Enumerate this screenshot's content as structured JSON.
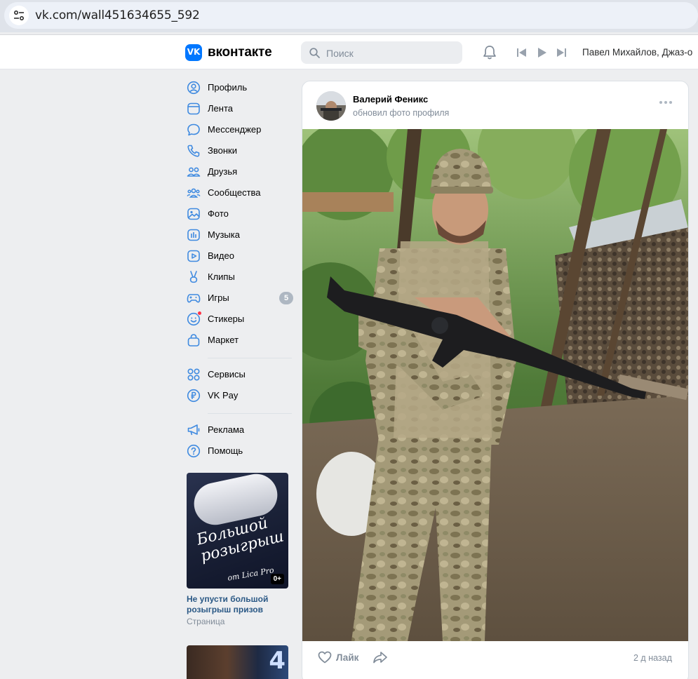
{
  "browser": {
    "url": "vk.com/wall451634655_592"
  },
  "header": {
    "logo_text": "вконтакте",
    "logo_mark": "VK",
    "search_placeholder": "Поиск",
    "player_track": "Павел Михайлов, Джаз-о"
  },
  "sidebar": {
    "items": [
      {
        "label": "Профиль",
        "icon": "user-circle-icon"
      },
      {
        "label": "Лента",
        "icon": "newsfeed-icon"
      },
      {
        "label": "Мессенджер",
        "icon": "chat-bubble-icon"
      },
      {
        "label": "Звонки",
        "icon": "phone-icon"
      },
      {
        "label": "Друзья",
        "icon": "friends-icon"
      },
      {
        "label": "Сообщества",
        "icon": "communities-icon"
      },
      {
        "label": "Фото",
        "icon": "photo-icon"
      },
      {
        "label": "Музыка",
        "icon": "music-icon"
      },
      {
        "label": "Видео",
        "icon": "video-icon"
      },
      {
        "label": "Клипы",
        "icon": "clips-icon"
      },
      {
        "label": "Игры",
        "icon": "gamepad-icon",
        "badge": "5"
      },
      {
        "label": "Стикеры",
        "icon": "sticker-icon"
      },
      {
        "label": "Маркет",
        "icon": "market-bag-icon"
      },
      {
        "label": "Сервисы",
        "icon": "services-grid-icon"
      },
      {
        "label": "VK Pay",
        "icon": "ruble-icon"
      },
      {
        "label": "Реклама",
        "icon": "megaphone-icon"
      },
      {
        "label": "Помощь",
        "icon": "help-icon"
      }
    ]
  },
  "promo": {
    "image_text_line1": "Большой",
    "image_text_line2": "розыгрыш",
    "image_text_sub": "от Lica Pro",
    "age": "0+",
    "title": "Не упусти большой розыгрыш призов",
    "type": "Страница",
    "next_number": "4"
  },
  "post": {
    "author": "Валерий Феникс",
    "action": "обновил фото профиля",
    "like_label": "Лайк",
    "time": "2 д назад"
  },
  "colors": {
    "accent": "#0077ff",
    "link": "#2a5885",
    "muted": "#818c99",
    "page_bg": "#edeef0"
  }
}
